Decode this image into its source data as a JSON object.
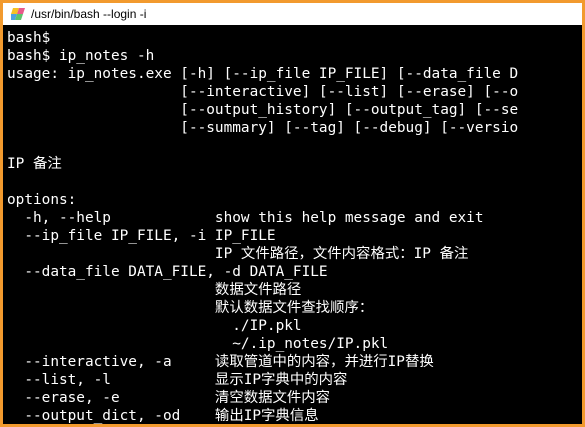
{
  "window": {
    "title": "/usr/bin/bash --login -i",
    "border_color": "#f29a2e",
    "background": "#000000",
    "foreground": "#ffffff",
    "icon": "mintty-terminal-icon"
  },
  "terminal": {
    "lines": [
      "bash$",
      "bash$ ip_notes -h",
      "usage: ip_notes.exe [-h] [--ip_file IP_FILE] [--data_file D",
      "                    [--interactive] [--list] [--erase] [--o",
      "                    [--output_history] [--output_tag] [--se",
      "                    [--summary] [--tag] [--debug] [--versio",
      "",
      "IP 备注",
      "",
      "options:",
      "  -h, --help            show this help message and exit",
      "  --ip_file IP_FILE, -i IP_FILE",
      "                        IP 文件路径，文件内容格式：IP 备注",
      "  --data_file DATA_FILE, -d DATA_FILE",
      "                        数据文件路径",
      "                        默认数据文件查找顺序：",
      "                          ./IP.pkl",
      "                          ~/.ip_notes/IP.pkl",
      "  --interactive, -a     读取管道中的内容，并进行IP替换",
      "  --list, -l            显示IP字典中的内容",
      "  --erase, -e           清空数据文件内容",
      "  --output_dict, -od    输出IP字典信息"
    ]
  }
}
